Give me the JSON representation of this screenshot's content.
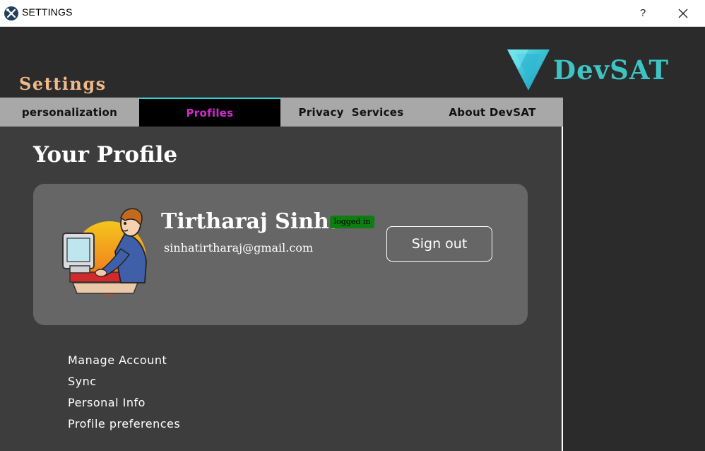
{
  "window": {
    "title": "SETTINGS",
    "help_label": "?",
    "close_icon": "close-icon"
  },
  "header": {
    "heading": "Settings",
    "brand": "DevSAT",
    "logo_icon": "triangle-logo-icon"
  },
  "tabs": [
    {
      "label": "personalization",
      "active": false
    },
    {
      "label": "Profiles",
      "active": true
    },
    {
      "label": "Privacy  Services",
      "active": false
    },
    {
      "label": "About DevSAT",
      "active": false
    }
  ],
  "profile": {
    "page_title": "Your Profile",
    "name": "Tirtharaj Sinha",
    "status": "logged in",
    "email": "sinhatirtharaj@gmail.com",
    "sign_out_label": "Sign out",
    "avatar_icon": "user-at-computer-avatar"
  },
  "links": [
    "Manage Account",
    "Sync",
    "Personal Info",
    "Profile preferences"
  ],
  "colors": {
    "accent_heading": "#f0b98a",
    "brand": "#3ec4c4",
    "active_tab_text": "#d12ad0",
    "active_tab_border": "#2fd6d6",
    "status_badge": "#0e7d12",
    "background": "#2b2b2b",
    "panel": "#3d3d3d",
    "card": "#666666"
  }
}
